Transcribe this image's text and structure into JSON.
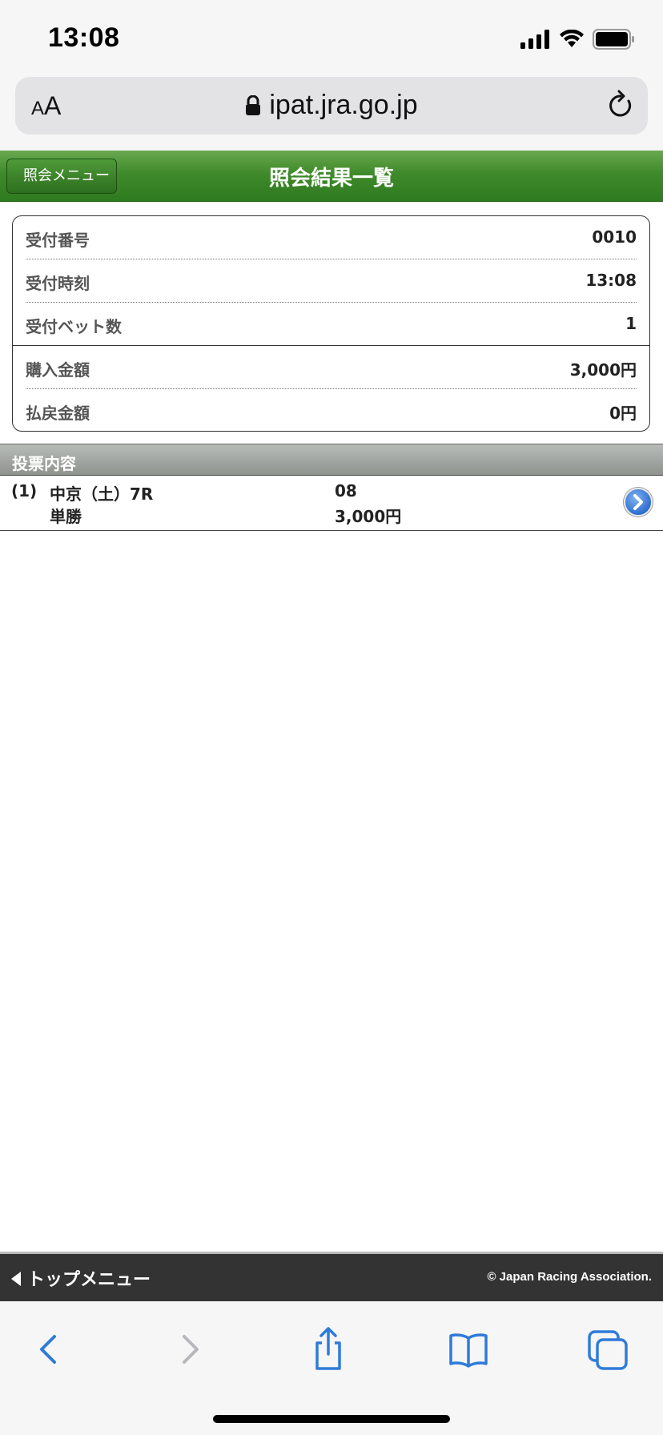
{
  "status_bar": {
    "time": "13:08"
  },
  "browser": {
    "text_size_small": "A",
    "text_size_large": "A",
    "url": "ipat.jra.go.jp"
  },
  "header": {
    "back_label": "照会メニュー",
    "title": "照会結果一覧"
  },
  "summary": {
    "rows": [
      {
        "label": "受付番号",
        "value": "0010"
      },
      {
        "label": "受付時刻",
        "value": "13:08"
      },
      {
        "label": "受付ベット数",
        "value": "1"
      },
      {
        "label": "購入金額",
        "value": "3,000円"
      },
      {
        "label": "払戻金額",
        "value": "0円"
      }
    ]
  },
  "votes": {
    "section_title": "投票内容",
    "items": [
      {
        "index": "(1)",
        "race": "中京（土）7R",
        "bet_type": "単勝",
        "selection": "08",
        "amount": "3,000円"
      }
    ]
  },
  "footer": {
    "top_menu_label": "トップメニュー",
    "copyright": "© Japan Racing Association."
  },
  "colors": {
    "header_green": "#3f8a2a",
    "link_blue": "#2f7bd9",
    "footer_dark": "#333333"
  },
  "icons": [
    "lock-icon",
    "reload-icon",
    "chevron-right-icon",
    "back-icon",
    "forward-icon",
    "share-icon",
    "bookmarks-icon",
    "tabs-icon"
  ]
}
